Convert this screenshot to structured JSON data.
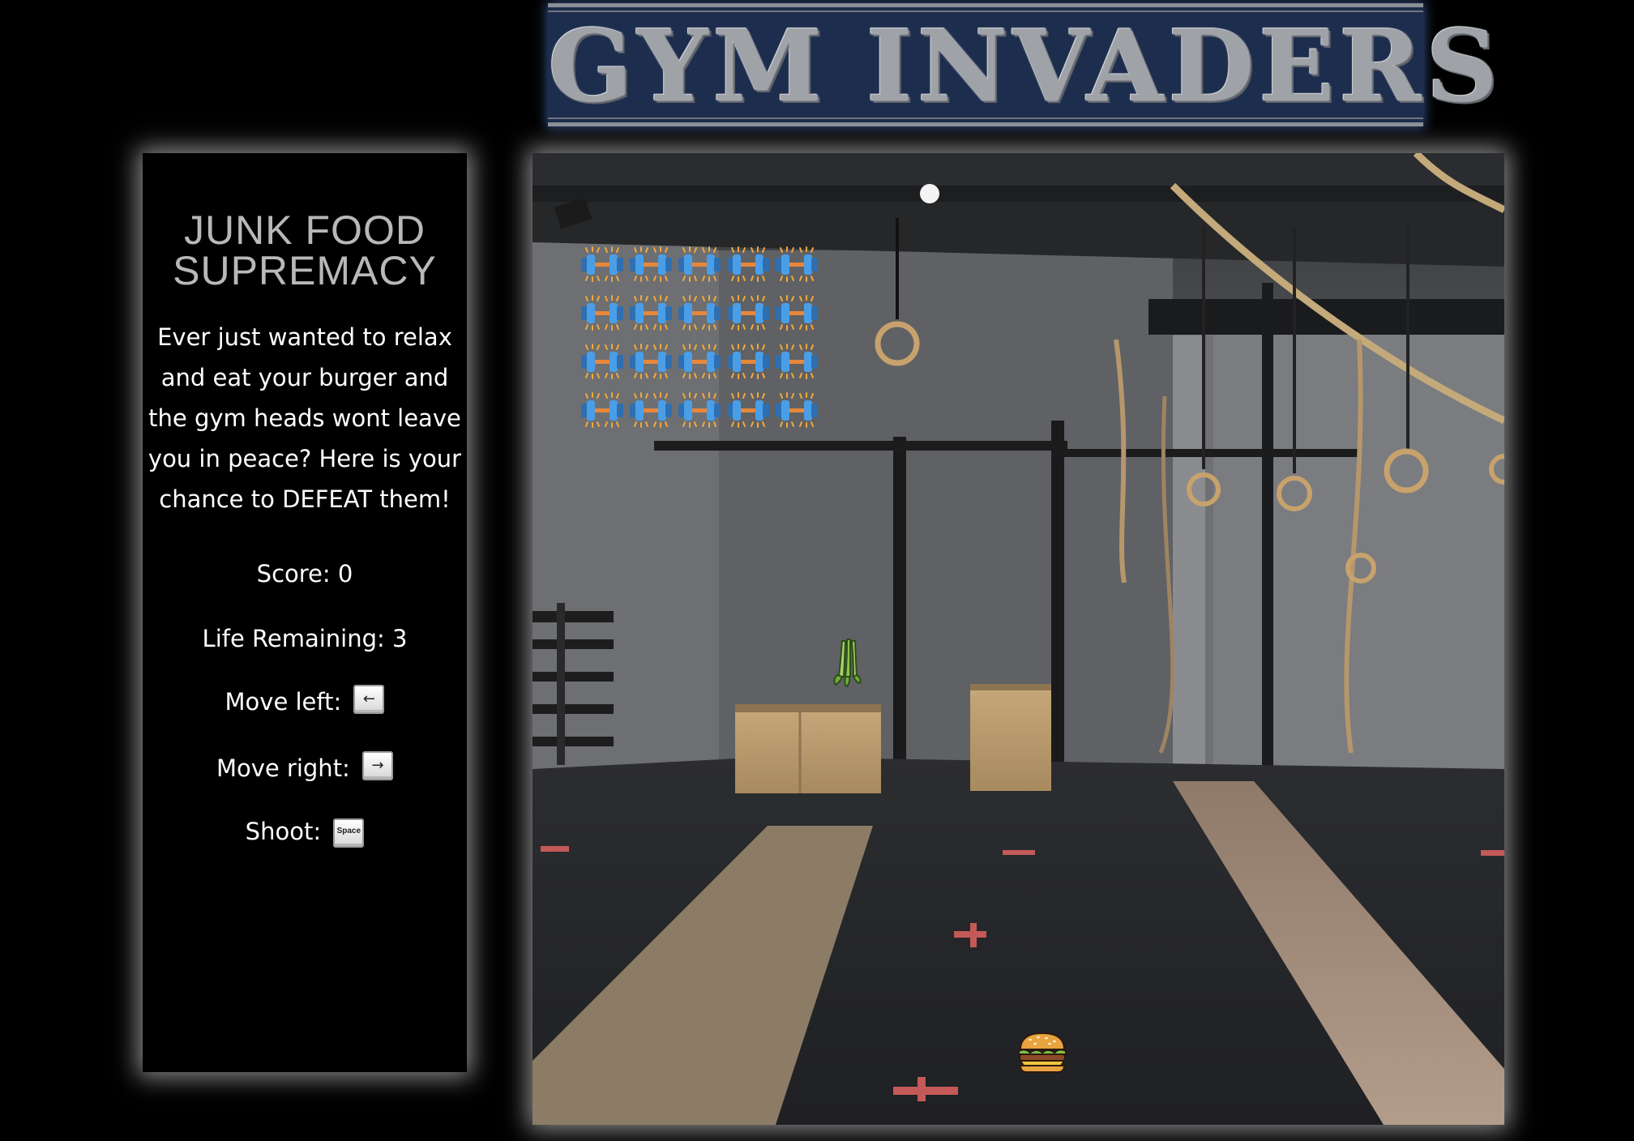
{
  "game": {
    "title": "GYM INVADERS"
  },
  "sidebar": {
    "heading_line1": "JUNK FOOD",
    "heading_line2": "SUPREMACY",
    "description": "Ever just wanted to relax and eat your burger and the gym heads wont leave you in peace? Here is your chance to DEFEAT them!",
    "score_label": "Score:",
    "score_value": "0",
    "life_label": "Life Remaining:",
    "life_value": "3",
    "move_left_label": "Move left:",
    "move_left_key": "←",
    "move_right_label": "Move right:",
    "move_right_key": "→",
    "shoot_label": "Shoot:",
    "shoot_key": "Space"
  },
  "state": {
    "enemy_rows": 4,
    "enemy_cols": 5,
    "enemy_icon": "dumbbell-icon",
    "player_icon": "burger-icon",
    "projectile_icon": "celery-icon"
  },
  "colors": {
    "background": "#000000",
    "title_banner": "#1d2d4d",
    "title_text": "#9fa3a8",
    "sidebar_heading": "#b8b8b8",
    "dumbbell_plate": "#4a9ee8",
    "dumbbell_bar": "#e8873a"
  }
}
